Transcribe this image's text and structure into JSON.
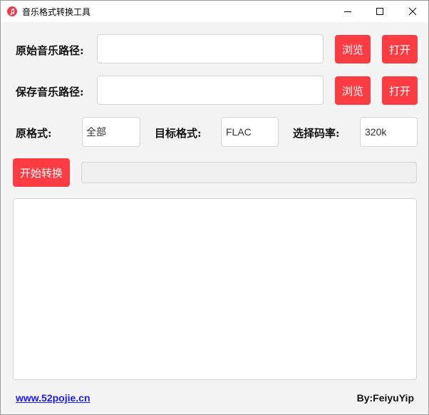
{
  "window": {
    "title": "音乐格式转换工具",
    "accent_color": "#fb3c43",
    "icons": {
      "app": "music-note-icon",
      "minimize": "minimize-icon",
      "maximize": "maximize-icon",
      "close": "close-icon"
    }
  },
  "source": {
    "label": "原始音乐路径:",
    "value": "",
    "browse_label": "浏览",
    "open_label": "打开"
  },
  "save": {
    "label": "保存音乐路径:",
    "value": "",
    "browse_label": "浏览",
    "open_label": "打开"
  },
  "formats": {
    "source_label": "原格式:",
    "source_value": "全部",
    "target_label": "目标格式:",
    "target_value": "FLAC",
    "bitrate_label": "选择码率:",
    "bitrate_value": "320k"
  },
  "convert": {
    "start_label": "开始转换",
    "progress": 0
  },
  "log": {
    "text": ""
  },
  "footer": {
    "link_text": "www.52pojie.cn",
    "author": "By:FeiyuYip"
  }
}
